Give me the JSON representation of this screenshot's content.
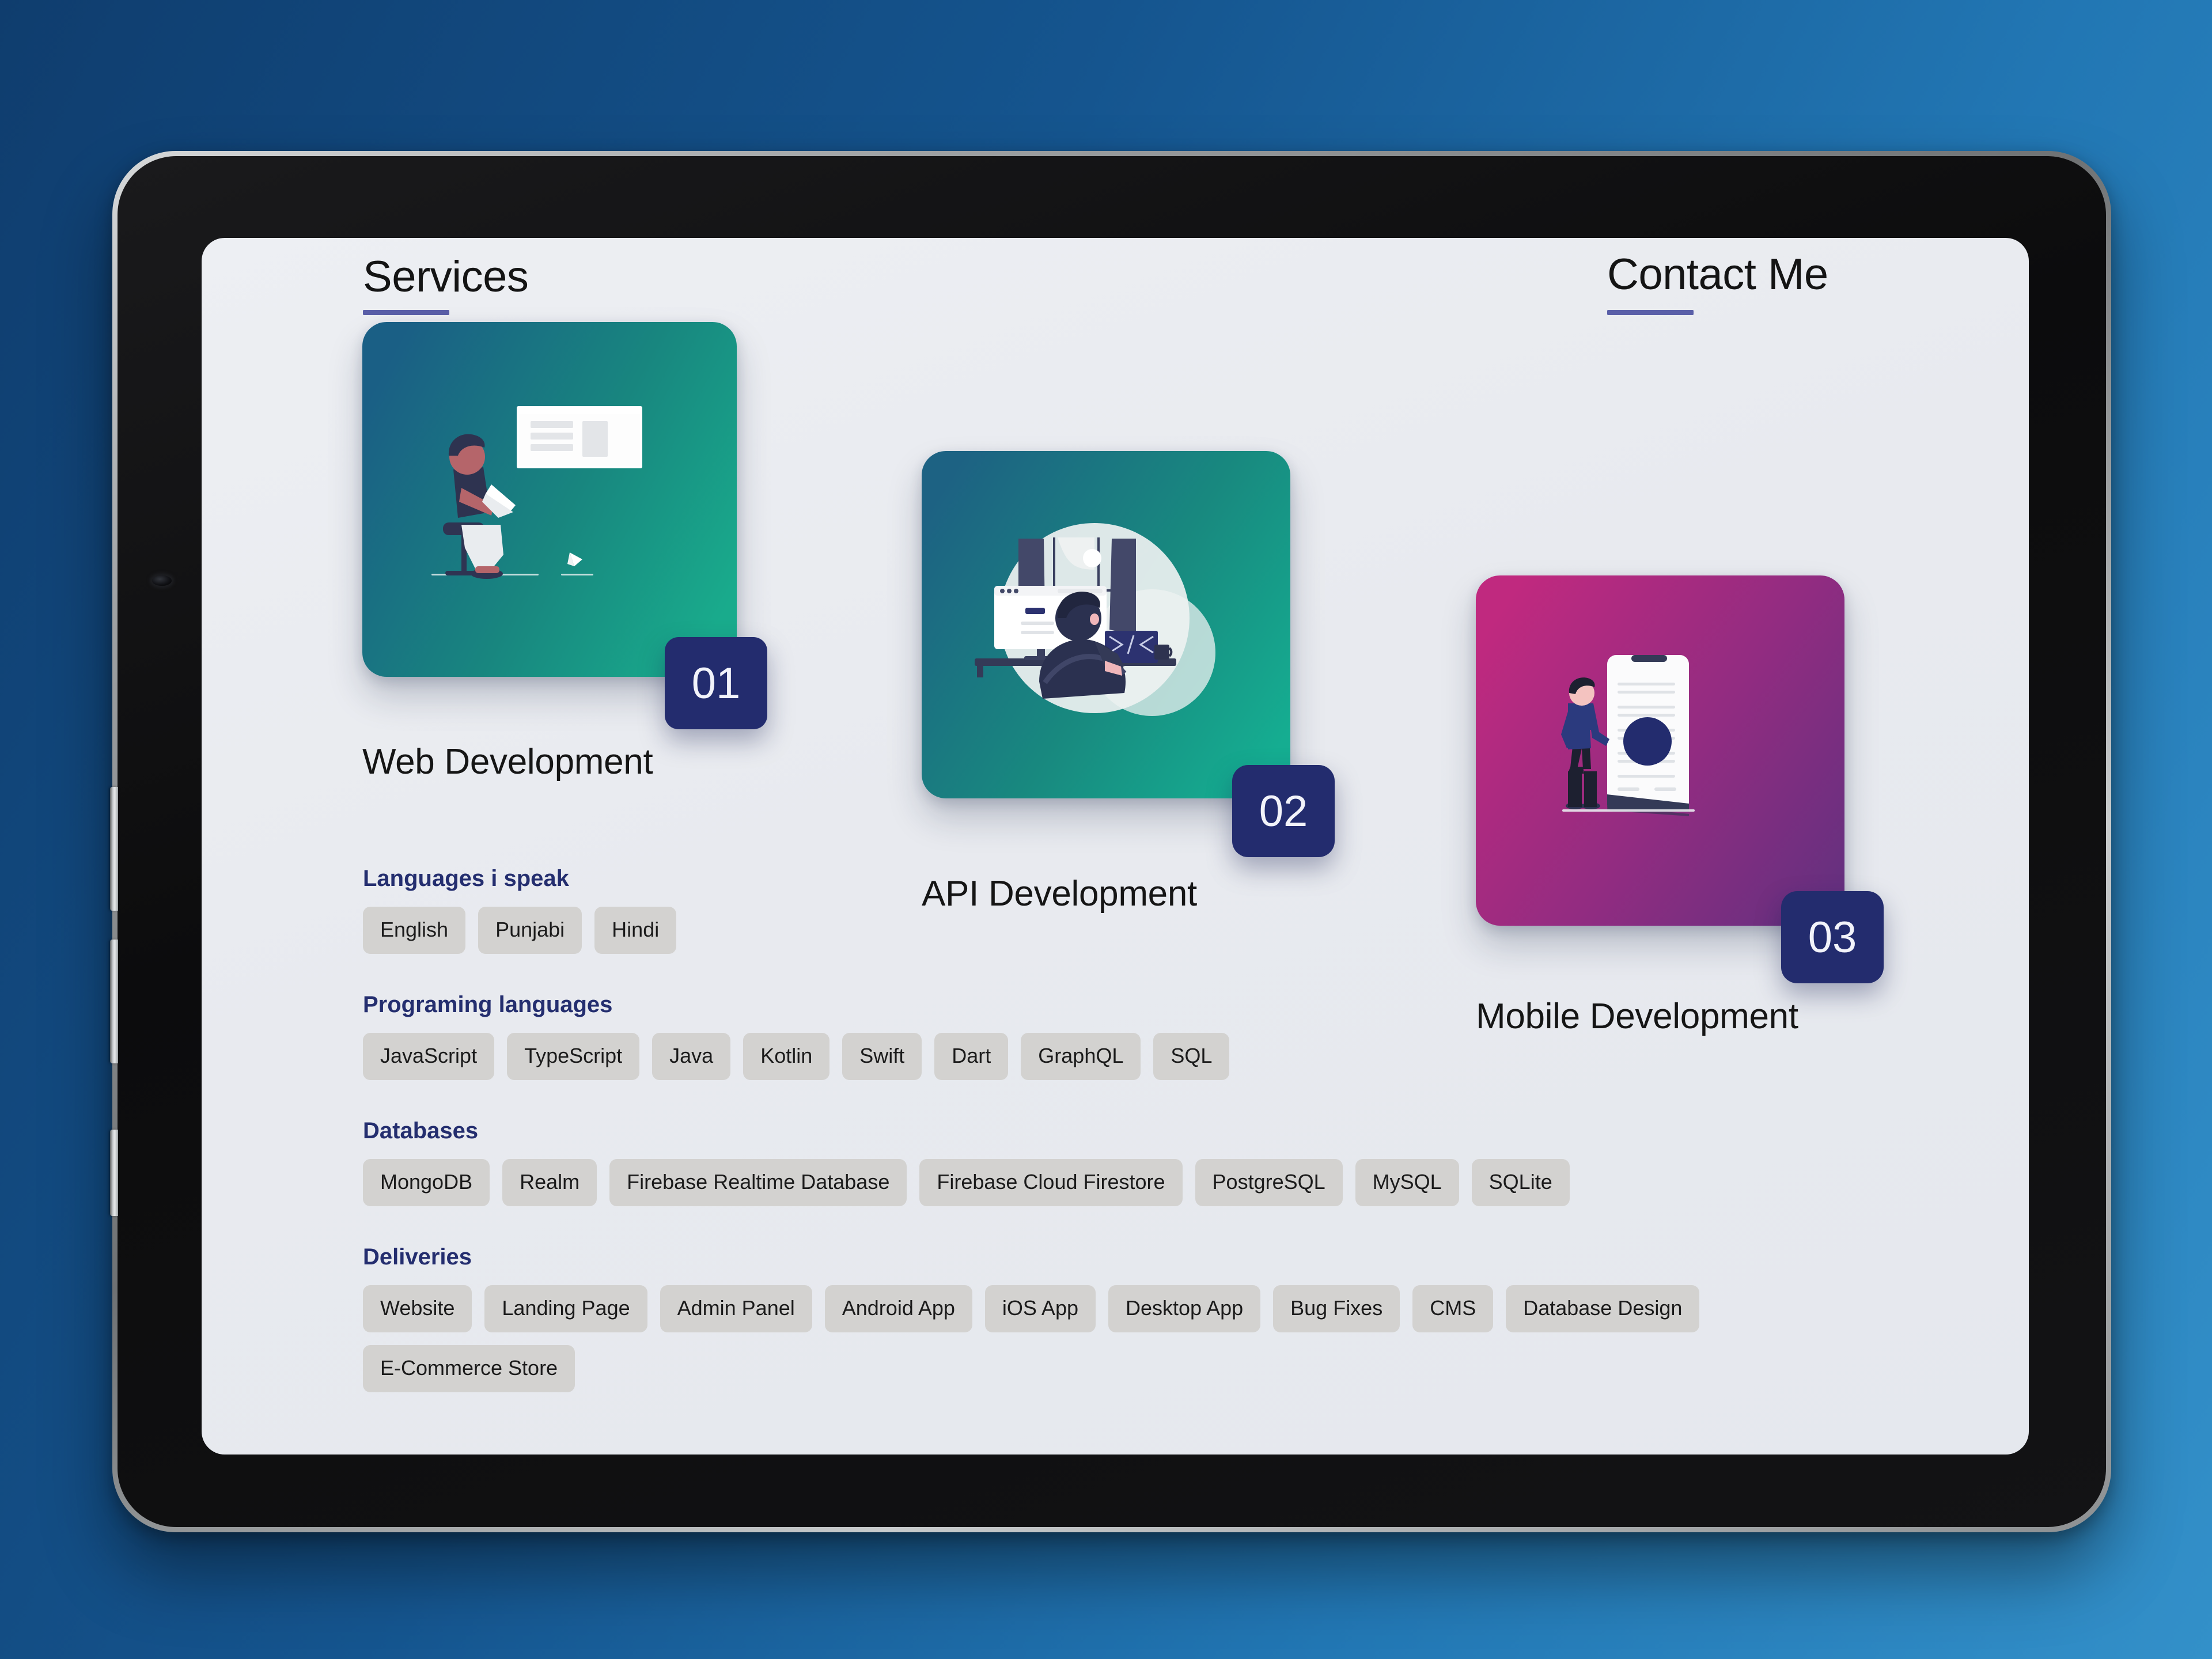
{
  "page": {
    "services_heading": "Services",
    "contact_heading": "Contact Me"
  },
  "services": [
    {
      "number": "01",
      "title": "Web Development",
      "illustration": "web-development-illustration",
      "gradient_from": "#1a5f85",
      "gradient_to": "#19a08a"
    },
    {
      "number": "02",
      "title": "API Development",
      "illustration": "api-development-illustration",
      "gradient_from": "#1d6283",
      "gradient_to": "#16a78f"
    },
    {
      "number": "03",
      "title": "Mobile Development",
      "illustration": "mobile-development-illustration",
      "gradient_from": "#bf2b7e",
      "gradient_to": "#6e2f83"
    }
  ],
  "skills": [
    {
      "title": "Languages i speak",
      "tags": [
        "English",
        "Punjabi",
        "Hindi"
      ]
    },
    {
      "title": "Programing languages",
      "tags": [
        "JavaScript",
        "TypeScript",
        "Java",
        "Kotlin",
        "Swift",
        "Dart",
        "GraphQL",
        "SQL"
      ]
    },
    {
      "title": "Databases",
      "tags": [
        "MongoDB",
        "Realm",
        "Firebase Realtime Database",
        "Firebase Cloud Firestore",
        "PostgreSQL",
        "MySQL",
        "SQLite"
      ]
    },
    {
      "title": "Deliveries",
      "tags": [
        "Website",
        "Landing Page",
        "Admin Panel",
        "Android App",
        "iOS App",
        "Desktop App",
        "Bug Fixes",
        "CMS",
        "Database Design",
        "E-Commerce Store"
      ]
    }
  ],
  "colors": {
    "accent_underline": "#5a5fa8",
    "badge_background": "#232c6e",
    "group_title": "#242e6f",
    "tag_background": "#d3d2d0",
    "screen_background": "#e9ebf0",
    "page_background_from": "#0f3d6e",
    "page_background_to": "#3390c9"
  }
}
